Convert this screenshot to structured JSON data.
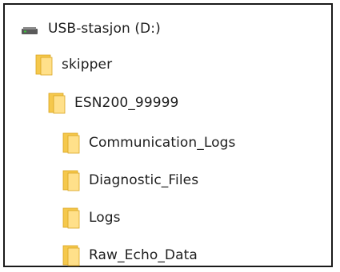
{
  "tree": {
    "drive": {
      "label": "USB-stasjon (D:)",
      "icon": "usb-drive-icon"
    },
    "items": [
      {
        "label": "skipper",
        "icon": "folder-icon",
        "depth": 1
      },
      {
        "label": "ESN200_99999",
        "icon": "folder-icon",
        "depth": 2
      },
      {
        "label": "Communication_Logs",
        "icon": "folder-icon",
        "depth": 3
      },
      {
        "label": "Diagnostic_Files",
        "icon": "folder-icon",
        "depth": 3
      },
      {
        "label": "Logs",
        "icon": "folder-icon",
        "depth": 3
      },
      {
        "label": "Raw_Echo_Data",
        "icon": "folder-icon",
        "depth": 3
      }
    ]
  },
  "colors": {
    "folder_body": "#f5c84c",
    "folder_front": "#ffe08a",
    "folder_edge": "#d9a520",
    "drive_body": "#5a5a5a",
    "drive_light": "#3fbf3f",
    "text": "#1e1e1e",
    "frame": "#1a1a1a"
  }
}
